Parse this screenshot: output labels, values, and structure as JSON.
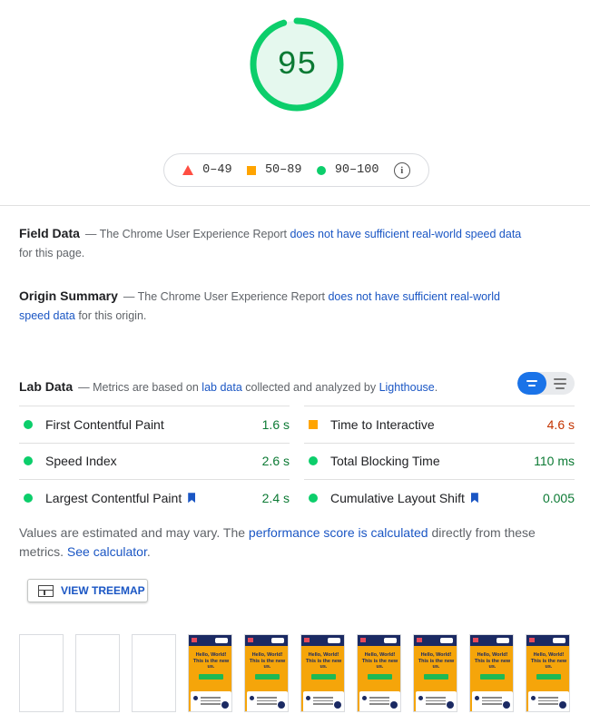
{
  "score": {
    "value": "95",
    "fraction": 0.95,
    "color": "#0cce6b"
  },
  "legend": {
    "fail": "0–49",
    "average": "50–89",
    "pass": "90–100"
  },
  "field_data": {
    "title": "Field Data",
    "prefix": "— The Chrome User Experience Report ",
    "link": "does not have sufficient real-world speed data",
    "suffix": " for this page."
  },
  "origin_summary": {
    "title": "Origin Summary",
    "prefix": "— The Chrome User Experience Report ",
    "link": "does not have sufficient real-world speed data",
    "suffix": " for this origin."
  },
  "lab_data": {
    "title": "Lab Data",
    "prefix": "— Metrics are based on ",
    "link1": "lab data",
    "middle": " collected and analyzed by ",
    "link2": "Lighthouse",
    "suffix": "."
  },
  "metrics": [
    [
      {
        "label": "First Contentful Paint",
        "value": "1.6 s",
        "status": "pass"
      },
      {
        "label": "Time to Interactive",
        "value": "4.6 s",
        "status": "average"
      }
    ],
    [
      {
        "label": "Speed Index",
        "value": "2.6 s",
        "status": "pass"
      },
      {
        "label": "Total Blocking Time",
        "value": "110 ms",
        "status": "pass"
      }
    ],
    [
      {
        "label": "Largest Contentful Paint",
        "value": "2.4 s",
        "status": "pass",
        "bookmark": true
      },
      {
        "label": "Cumulative Layout Shift",
        "value": "0.005",
        "status": "pass",
        "bookmark": true
      }
    ]
  ],
  "note": {
    "prefix": "Values are estimated and may vary. The ",
    "link1": "performance score is calculated",
    "middle": " directly from these metrics. ",
    "link2": "See calculator",
    "suffix": "."
  },
  "treemap_button": "VIEW TREEMAP",
  "filmstrip": {
    "blank_frames": 3,
    "loaded_frames": 7,
    "headline": "Hello, World! This is the new us."
  }
}
